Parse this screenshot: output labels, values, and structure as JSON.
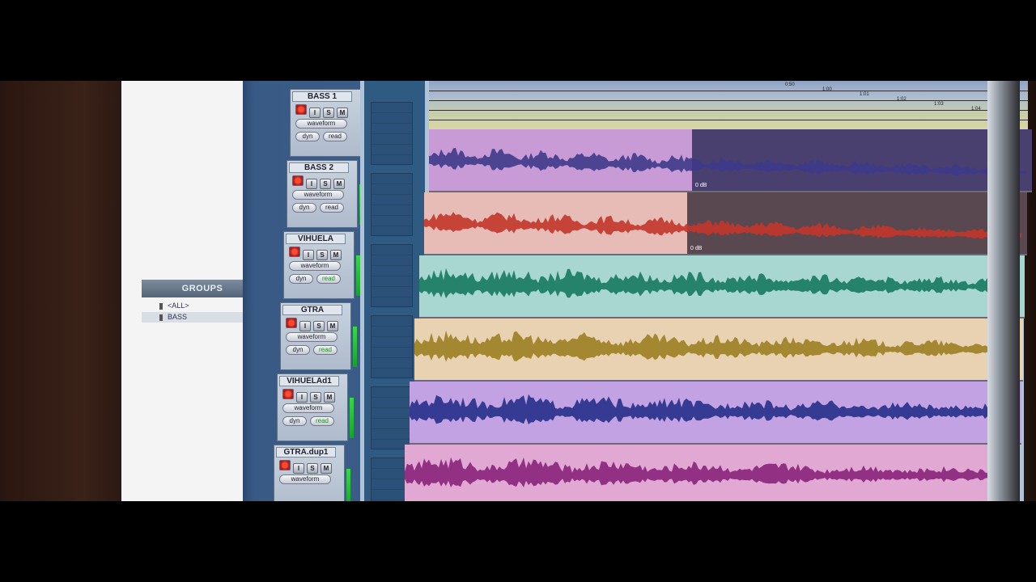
{
  "groups": {
    "header": "GROUPS",
    "items": [
      {
        "marker": "!",
        "label": "<ALL>"
      },
      {
        "marker": "a",
        "label": "BASS"
      }
    ]
  },
  "tracks": [
    {
      "name": "BASS 1",
      "buttons": [
        "I",
        "S",
        "M"
      ],
      "view": "waveform",
      "dyn": "dyn",
      "automation": "read",
      "color": "#c89ad6",
      "wave": "#3e3a8a"
    },
    {
      "name": "BASS 2",
      "buttons": [
        "I",
        "S",
        "M"
      ],
      "view": "waveform",
      "dyn": "dyn",
      "automation": "read",
      "color": "#e8bcb6",
      "wave": "#c2352a"
    },
    {
      "name": "VIHUELA",
      "buttons": [
        "I",
        "S",
        "M"
      ],
      "view": "waveform",
      "dyn": "dyn",
      "automation": "read",
      "color": "#a8d6d0",
      "wave": "#157a5e"
    },
    {
      "name": "GTRA",
      "buttons": [
        "I",
        "S",
        "M"
      ],
      "view": "waveform",
      "dyn": "dyn",
      "automation": "read",
      "color": "#e8d2b2",
      "wave": "#9c8022"
    },
    {
      "name": "VIHUELAd1",
      "buttons": [
        "I",
        "S",
        "M"
      ],
      "view": "waveform",
      "dyn": "dyn",
      "automation": "read",
      "color": "#c2a2e2",
      "wave": "#26308a"
    },
    {
      "name": "GTRA.dup1",
      "buttons": [
        "I",
        "S",
        "M"
      ],
      "view": "waveform",
      "dyn": "",
      "automation": "",
      "color": "#e2a8d4",
      "wave": "#8a247a"
    }
  ],
  "clip_gains": [
    "0 dB",
    "0 dB"
  ],
  "ruler_labels": [
    "0:50",
    "1:00",
    "1:01",
    "1:02",
    "1:03",
    "1:04"
  ]
}
